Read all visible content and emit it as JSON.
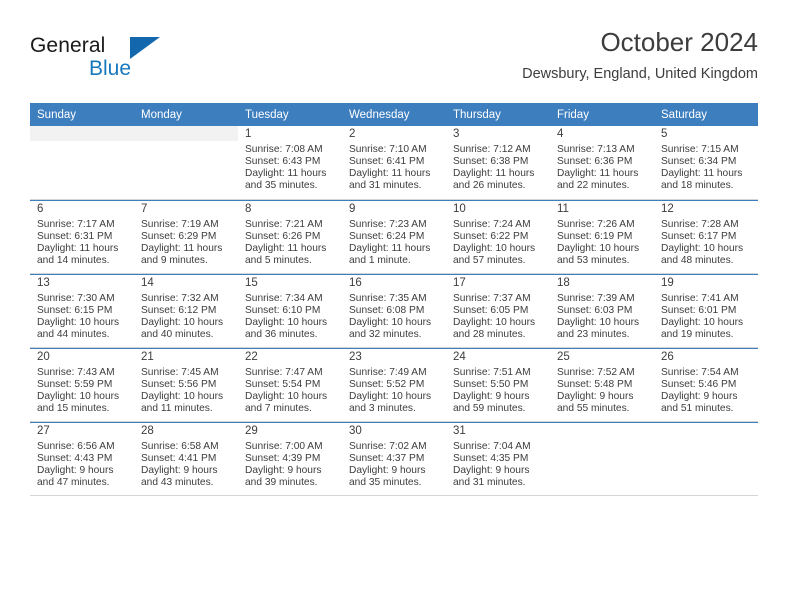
{
  "brand": {
    "name_part1": "General",
    "name_part2": "Blue",
    "triangle_color": "#1267ad",
    "blue_text_color": "#1878be"
  },
  "header": {
    "title": "October 2024",
    "subtitle": "Dewsbury, England, United Kingdom"
  },
  "theme": {
    "header_row_bg": "#3d7ebf",
    "daynum_bar_bg": "#f2f2f2",
    "grid_line": "#d5d5d5",
    "text": "#3d3d3d"
  },
  "weekday_headers": [
    "Sunday",
    "Monday",
    "Tuesday",
    "Wednesday",
    "Thursday",
    "Friday",
    "Saturday"
  ],
  "weeks": [
    [
      {
        "day": "",
        "sunrise": "",
        "sunset": "",
        "daylight_line1": "",
        "daylight_line2": "",
        "empty": true
      },
      {
        "day": "",
        "sunrise": "",
        "sunset": "",
        "daylight_line1": "",
        "daylight_line2": "",
        "empty": true
      },
      {
        "day": "1",
        "sunrise": "Sunrise: 7:08 AM",
        "sunset": "Sunset: 6:43 PM",
        "daylight_line1": "Daylight: 11 hours",
        "daylight_line2": "and 35 minutes."
      },
      {
        "day": "2",
        "sunrise": "Sunrise: 7:10 AM",
        "sunset": "Sunset: 6:41 PM",
        "daylight_line1": "Daylight: 11 hours",
        "daylight_line2": "and 31 minutes."
      },
      {
        "day": "3",
        "sunrise": "Sunrise: 7:12 AM",
        "sunset": "Sunset: 6:38 PM",
        "daylight_line1": "Daylight: 11 hours",
        "daylight_line2": "and 26 minutes."
      },
      {
        "day": "4",
        "sunrise": "Sunrise: 7:13 AM",
        "sunset": "Sunset: 6:36 PM",
        "daylight_line1": "Daylight: 11 hours",
        "daylight_line2": "and 22 minutes."
      },
      {
        "day": "5",
        "sunrise": "Sunrise: 7:15 AM",
        "sunset": "Sunset: 6:34 PM",
        "daylight_line1": "Daylight: 11 hours",
        "daylight_line2": "and 18 minutes."
      }
    ],
    [
      {
        "day": "6",
        "sunrise": "Sunrise: 7:17 AM",
        "sunset": "Sunset: 6:31 PM",
        "daylight_line1": "Daylight: 11 hours",
        "daylight_line2": "and 14 minutes."
      },
      {
        "day": "7",
        "sunrise": "Sunrise: 7:19 AM",
        "sunset": "Sunset: 6:29 PM",
        "daylight_line1": "Daylight: 11 hours",
        "daylight_line2": "and 9 minutes."
      },
      {
        "day": "8",
        "sunrise": "Sunrise: 7:21 AM",
        "sunset": "Sunset: 6:26 PM",
        "daylight_line1": "Daylight: 11 hours",
        "daylight_line2": "and 5 minutes."
      },
      {
        "day": "9",
        "sunrise": "Sunrise: 7:23 AM",
        "sunset": "Sunset: 6:24 PM",
        "daylight_line1": "Daylight: 11 hours",
        "daylight_line2": "and 1 minute."
      },
      {
        "day": "10",
        "sunrise": "Sunrise: 7:24 AM",
        "sunset": "Sunset: 6:22 PM",
        "daylight_line1": "Daylight: 10 hours",
        "daylight_line2": "and 57 minutes."
      },
      {
        "day": "11",
        "sunrise": "Sunrise: 7:26 AM",
        "sunset": "Sunset: 6:19 PM",
        "daylight_line1": "Daylight: 10 hours",
        "daylight_line2": "and 53 minutes."
      },
      {
        "day": "12",
        "sunrise": "Sunrise: 7:28 AM",
        "sunset": "Sunset: 6:17 PM",
        "daylight_line1": "Daylight: 10 hours",
        "daylight_line2": "and 48 minutes."
      }
    ],
    [
      {
        "day": "13",
        "sunrise": "Sunrise: 7:30 AM",
        "sunset": "Sunset: 6:15 PM",
        "daylight_line1": "Daylight: 10 hours",
        "daylight_line2": "and 44 minutes."
      },
      {
        "day": "14",
        "sunrise": "Sunrise: 7:32 AM",
        "sunset": "Sunset: 6:12 PM",
        "daylight_line1": "Daylight: 10 hours",
        "daylight_line2": "and 40 minutes."
      },
      {
        "day": "15",
        "sunrise": "Sunrise: 7:34 AM",
        "sunset": "Sunset: 6:10 PM",
        "daylight_line1": "Daylight: 10 hours",
        "daylight_line2": "and 36 minutes."
      },
      {
        "day": "16",
        "sunrise": "Sunrise: 7:35 AM",
        "sunset": "Sunset: 6:08 PM",
        "daylight_line1": "Daylight: 10 hours",
        "daylight_line2": "and 32 minutes."
      },
      {
        "day": "17",
        "sunrise": "Sunrise: 7:37 AM",
        "sunset": "Sunset: 6:05 PM",
        "daylight_line1": "Daylight: 10 hours",
        "daylight_line2": "and 28 minutes."
      },
      {
        "day": "18",
        "sunrise": "Sunrise: 7:39 AM",
        "sunset": "Sunset: 6:03 PM",
        "daylight_line1": "Daylight: 10 hours",
        "daylight_line2": "and 23 minutes."
      },
      {
        "day": "19",
        "sunrise": "Sunrise: 7:41 AM",
        "sunset": "Sunset: 6:01 PM",
        "daylight_line1": "Daylight: 10 hours",
        "daylight_line2": "and 19 minutes."
      }
    ],
    [
      {
        "day": "20",
        "sunrise": "Sunrise: 7:43 AM",
        "sunset": "Sunset: 5:59 PM",
        "daylight_line1": "Daylight: 10 hours",
        "daylight_line2": "and 15 minutes."
      },
      {
        "day": "21",
        "sunrise": "Sunrise: 7:45 AM",
        "sunset": "Sunset: 5:56 PM",
        "daylight_line1": "Daylight: 10 hours",
        "daylight_line2": "and 11 minutes."
      },
      {
        "day": "22",
        "sunrise": "Sunrise: 7:47 AM",
        "sunset": "Sunset: 5:54 PM",
        "daylight_line1": "Daylight: 10 hours",
        "daylight_line2": "and 7 minutes."
      },
      {
        "day": "23",
        "sunrise": "Sunrise: 7:49 AM",
        "sunset": "Sunset: 5:52 PM",
        "daylight_line1": "Daylight: 10 hours",
        "daylight_line2": "and 3 minutes."
      },
      {
        "day": "24",
        "sunrise": "Sunrise: 7:51 AM",
        "sunset": "Sunset: 5:50 PM",
        "daylight_line1": "Daylight: 9 hours",
        "daylight_line2": "and 59 minutes."
      },
      {
        "day": "25",
        "sunrise": "Sunrise: 7:52 AM",
        "sunset": "Sunset: 5:48 PM",
        "daylight_line1": "Daylight: 9 hours",
        "daylight_line2": "and 55 minutes."
      },
      {
        "day": "26",
        "sunrise": "Sunrise: 7:54 AM",
        "sunset": "Sunset: 5:46 PM",
        "daylight_line1": "Daylight: 9 hours",
        "daylight_line2": "and 51 minutes."
      }
    ],
    [
      {
        "day": "27",
        "sunrise": "Sunrise: 6:56 AM",
        "sunset": "Sunset: 4:43 PM",
        "daylight_line1": "Daylight: 9 hours",
        "daylight_line2": "and 47 minutes."
      },
      {
        "day": "28",
        "sunrise": "Sunrise: 6:58 AM",
        "sunset": "Sunset: 4:41 PM",
        "daylight_line1": "Daylight: 9 hours",
        "daylight_line2": "and 43 minutes."
      },
      {
        "day": "29",
        "sunrise": "Sunrise: 7:00 AM",
        "sunset": "Sunset: 4:39 PM",
        "daylight_line1": "Daylight: 9 hours",
        "daylight_line2": "and 39 minutes."
      },
      {
        "day": "30",
        "sunrise": "Sunrise: 7:02 AM",
        "sunset": "Sunset: 4:37 PM",
        "daylight_line1": "Daylight: 9 hours",
        "daylight_line2": "and 35 minutes."
      },
      {
        "day": "31",
        "sunrise": "Sunrise: 7:04 AM",
        "sunset": "Sunset: 4:35 PM",
        "daylight_line1": "Daylight: 9 hours",
        "daylight_line2": "and 31 minutes."
      },
      {
        "day": "",
        "sunrise": "",
        "sunset": "",
        "daylight_line1": "",
        "daylight_line2": "",
        "blank": true
      },
      {
        "day": "",
        "sunrise": "",
        "sunset": "",
        "daylight_line1": "",
        "daylight_line2": "",
        "blank": true
      }
    ]
  ]
}
